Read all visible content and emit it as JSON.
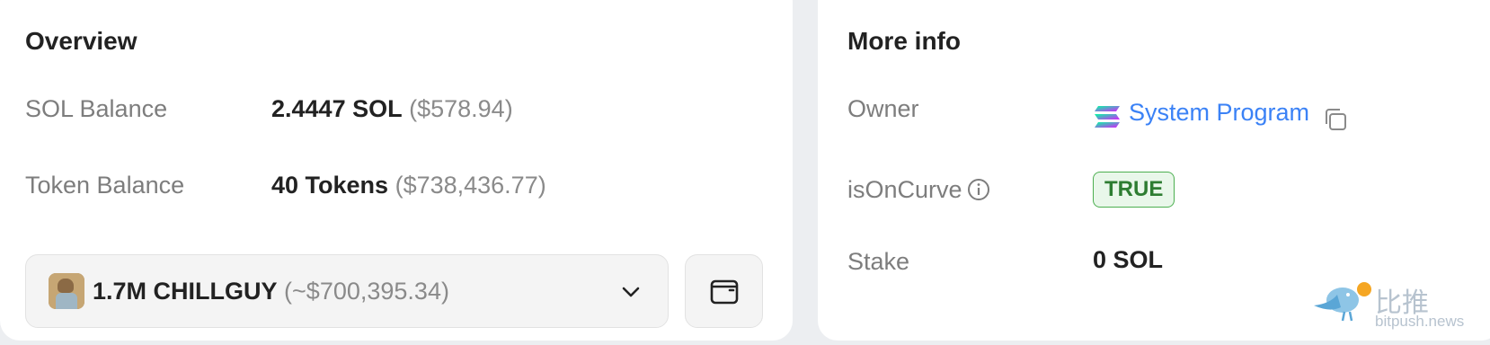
{
  "overview": {
    "title": "Overview",
    "sol_balance": {
      "label": "SOL Balance",
      "value": "2.4447 SOL",
      "usd": "($578.94)"
    },
    "token_balance": {
      "label": "Token Balance",
      "value": "40 Tokens",
      "usd": "($738,436.77)"
    },
    "token_select": {
      "amount": "1.7M CHILLGUY",
      "usd": "(~$700,395.34)",
      "icon": "chillguy-token-avatar"
    },
    "wallet_button_icon": "wallet-icon"
  },
  "more_info": {
    "title": "More info",
    "owner": {
      "label": "Owner",
      "value": "System Program",
      "logo": "solana-logo",
      "copy_icon": "copy-icon"
    },
    "is_on_curve": {
      "label": "isOnCurve",
      "badge": "TRUE",
      "icon": "info-icon"
    },
    "stake": {
      "label": "Stake",
      "value": "0 SOL"
    }
  },
  "watermark": {
    "cn": "比推",
    "en": "bitpush.news"
  },
  "colors": {
    "link": "#3b82f6",
    "badge_green": "#2e7d32",
    "badge_bg": "#e9f7ea"
  }
}
